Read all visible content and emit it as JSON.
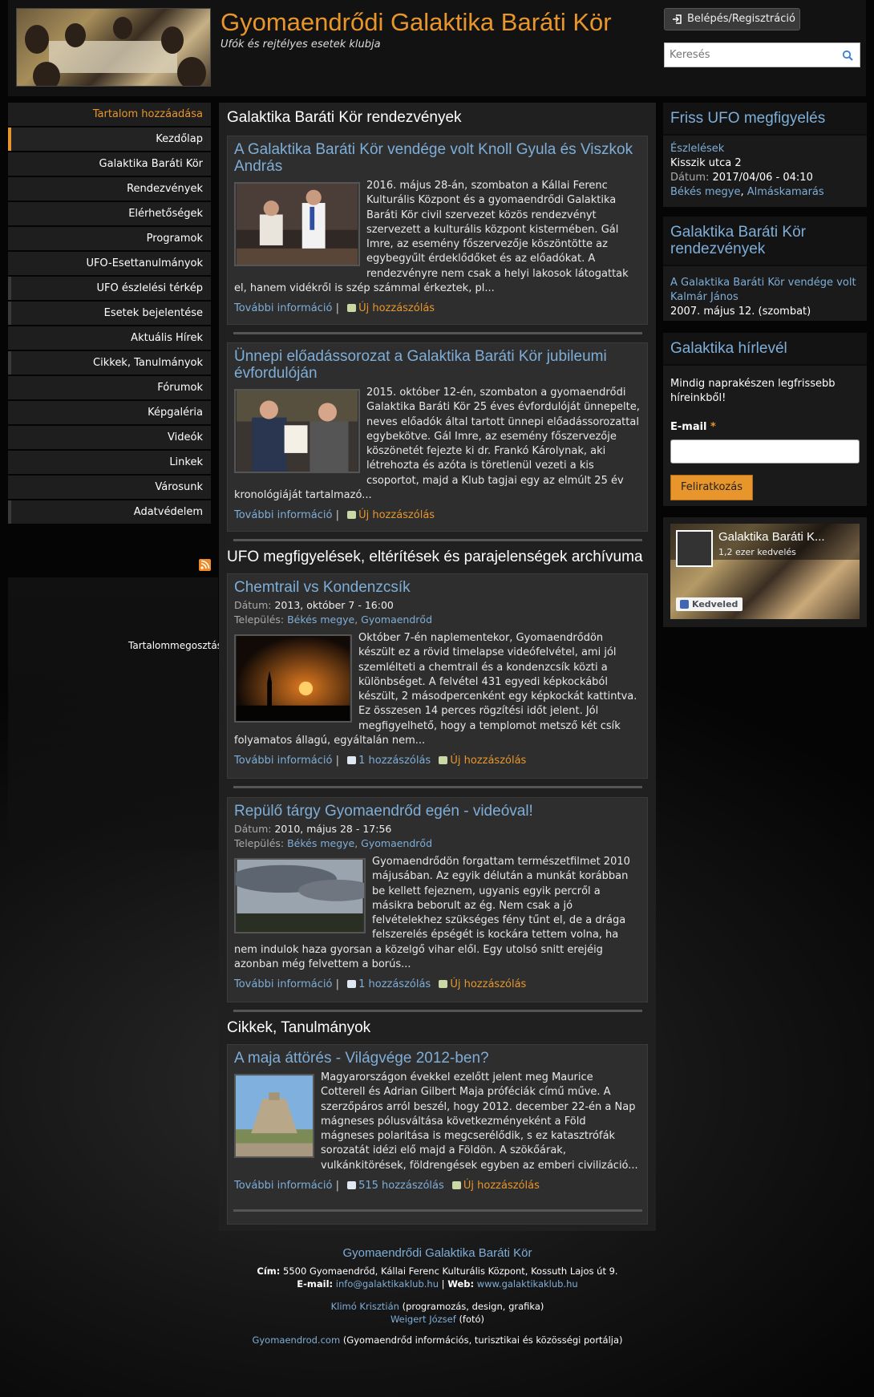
{
  "header": {
    "site_name": "Gyomaendrődi Galaktika Baráti Kör",
    "slogan": "Ufók és rejtélyes esetek klubja",
    "login_label": "Belépés/Regisztráció",
    "search_placeholder": "Keresés"
  },
  "nav": {
    "add_content": "Tartalom hozzáadása",
    "items": [
      "Kezdőlap",
      "Galaktika Baráti Kör",
      "Rendezvények",
      "Elérhetőségek",
      "Programok",
      "UFO-Esettanulmányok",
      "UFO észlelési térkép",
      "Esetek bejelentése",
      "Aktuális Hírek",
      "Cikkek, Tanulmányok",
      "Fórumok",
      "Képgaléria",
      "Videók",
      "Linkek",
      "Városunk",
      "Adatvédelem"
    ],
    "share_label": "Tartalommegosztás"
  },
  "main": {
    "section1_title": "Galaktika Baráti Kör rendezvények",
    "section2_title": "UFO megfigyelések, eltérítések és parajelenségek archívuma",
    "section3_title": "Cikkek, Tanulmányok",
    "more_label": "További információ",
    "new_comment_label": "Új hozzászólás",
    "date_label": "Dátum:",
    "place_label": "Település:",
    "node1": {
      "title": "A Galaktika Baráti Kör vendége volt Knoll Gyula és Viszkok András",
      "text": "2016. május 28-án, szombaton a Kállai Ferenc Kulturális Központ és a gyomaendrődi Galaktika Baráti Kör civil szervezet közös rendezvényt szervezett a kulturális központ kistermében. Gál Imre, az esemény főszervezője köszöntötte az egybegyűlt érdeklődőket és az előadókat. A rendezvényre nem csak a helyi lakosok látogattak el, hanem vidékről is szép számmal érkeztek, pl..."
    },
    "node2": {
      "title": "Ünnepi előadássorozat a Galaktika Baráti Kör jubileumi évfordulóján",
      "text": "2015. október 12-én, szombaton a gyomaendrődi Galaktika Baráti Kör 25 éves évfordulóját ünnepelte, neves előadók által tartott ünnepi előadássorozattal egybekötve. Gál Imre, az esemény főszervezője köszönetét fejezte ki dr. Frankó Károlynak, aki létrehozta és azóta is töretlenül vezeti a kis csoportot, majd a Klub tagjai egy az elmúlt 25 év kronológiáját tartalmazó..."
    },
    "node3": {
      "title": "Chemtrail vs Kondenzcsík",
      "date": "2013, október 7 - 16:00",
      "county": "Békés megye",
      "city": "Gyomaendrőd",
      "comments": "1 hozzászólás",
      "text": "Október 7-én naplementekor, Gyomaendrődön készült ez a rövid timelapse videófelvétel, ami jól szemlélteti a chemtrail és a kondenzcsík közti a különbséget. A felvétel 431 egyedi képkockából készült, 2 másodpercenként egy képkockát kattintva. Ez összesen 14 perces rögzítési időt jelent. Jól megfigyelhető, hogy a templomot metsző két csík folyamatos állagú, egyáltalán nem..."
    },
    "node4": {
      "title": "Repülő tárgy Gyomaendrőd egén - videóval!",
      "date": "2010, május 28 - 17:56",
      "county": "Békés megye",
      "city": "Gyomaendrőd",
      "comments": "1 hozzászólás",
      "text": "Gyomaendrődön forgattam természetfilmet 2010 májusában. Az egyik délután a munkát korábban be kellett fejeznem, ugyanis egyik percről a másikra beborult az ég. Nem csak a jó felvételekhez szükséges fény tűnt el, de a drága felszerelés épségét is kockára tettem volna, ha nem indulok haza gyorsan a közelgő vihar elől. Egy utolsó snitt erejéig azonban még felvettem a borús..."
    },
    "node5": {
      "title": "A maja áttörés - Világvége 2012-ben?",
      "comments": "515 hozzászólás",
      "text": "Magyarországon évekkel ezelőtt jelent meg Maurice Cotterell és Adrian Gilbert Maja próféciák című műve. A szerzőpáros arról beszél, hogy 2012. december 22-én a Nap mágneses pólusváltása következményeként a Föld mágneses polaritása is megcserélődik, s ez katasztrófák sorozatát idézi elő majd a Földön. A szökőárak, vulkánkitörések, földrengések egyben az emberi civilizáció..."
    }
  },
  "right": {
    "ufo_title": "Friss UFO megfigyelés",
    "ufo_category": "Észlelések",
    "ufo_place": "Kisszik utca 2",
    "ufo_date_label": "Dátum:",
    "ufo_date": "2017/04/06 - 04:10",
    "ufo_county": "Békés megye",
    "ufo_city": "Almáskamarás",
    "events_title": "Galaktika Baráti Kör rendezvények",
    "event_link": "A Galaktika Baráti Kör vendége volt Kalmár János",
    "event_date": "2007. május 12. (szombat)",
    "newsletter_title": "Galaktika hírlevél",
    "newsletter_text": "Mindig naprakészen legfrissebb híreinkből!",
    "email_label": "E-mail",
    "required_mark": "*",
    "subscribe_label": "Feliratkozás",
    "fb_name": "Galaktika Baráti K...",
    "fb_likes": "1,2 ezer kedvelés",
    "fb_like_btn": "Kedveled"
  },
  "footer": {
    "name": "Gyomaendrődi Galaktika Baráti Kör",
    "address_label": "Cím:",
    "address": "5500 Gyomaendrőd, Kállai Ferenc Kulturális Központ, Kossuth Lajos út 9.",
    "email_label": "E-mail:",
    "email": "info@galaktikaklub.hu",
    "web_label": "Web:",
    "web": "www.galaktikaklub.hu",
    "credit1_name": "Klimó Krisztián",
    "credit1_role": "(programozás, design, grafika)",
    "credit2_name": "Weigert József",
    "credit2_role": "(fotó)",
    "portal_link": "Gyomaendrod.com",
    "portal_desc": "(Gyomaendrőd információs, turisztikai és közösségi portálja)"
  },
  "colors": {
    "accent": "#e8962b",
    "link": "#7eaed8",
    "panel": "#2e2e2e"
  }
}
